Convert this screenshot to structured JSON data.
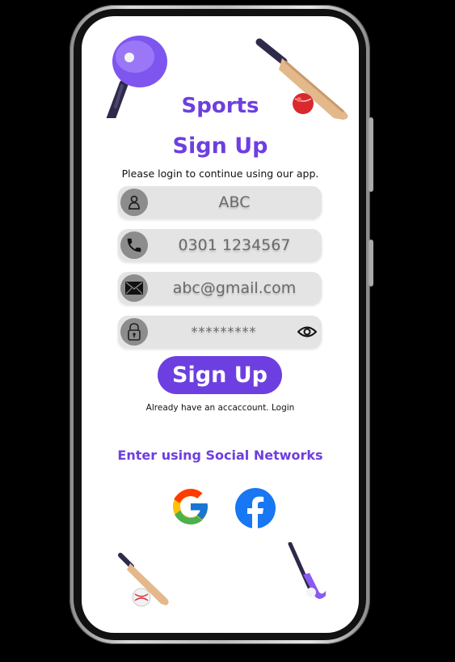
{
  "header": {
    "brand": "Sports",
    "title": "Sign Up",
    "subtitle": "Please login to continue using our app."
  },
  "form": {
    "name_value": "ABC",
    "phone_value": "0301 1234567",
    "email_value": "abc@gmail.com",
    "password_value": "*********"
  },
  "actions": {
    "signup_label": "Sign Up",
    "login_prompt": "Already have an accaccount. Login"
  },
  "social": {
    "title": "Enter using Social Networks",
    "google_icon": "google-icon",
    "facebook_icon": "facebook-icon"
  },
  "colors": {
    "accent": "#6d3fe0",
    "field_bg": "#e4e4e4",
    "facebook": "#1877f2"
  }
}
